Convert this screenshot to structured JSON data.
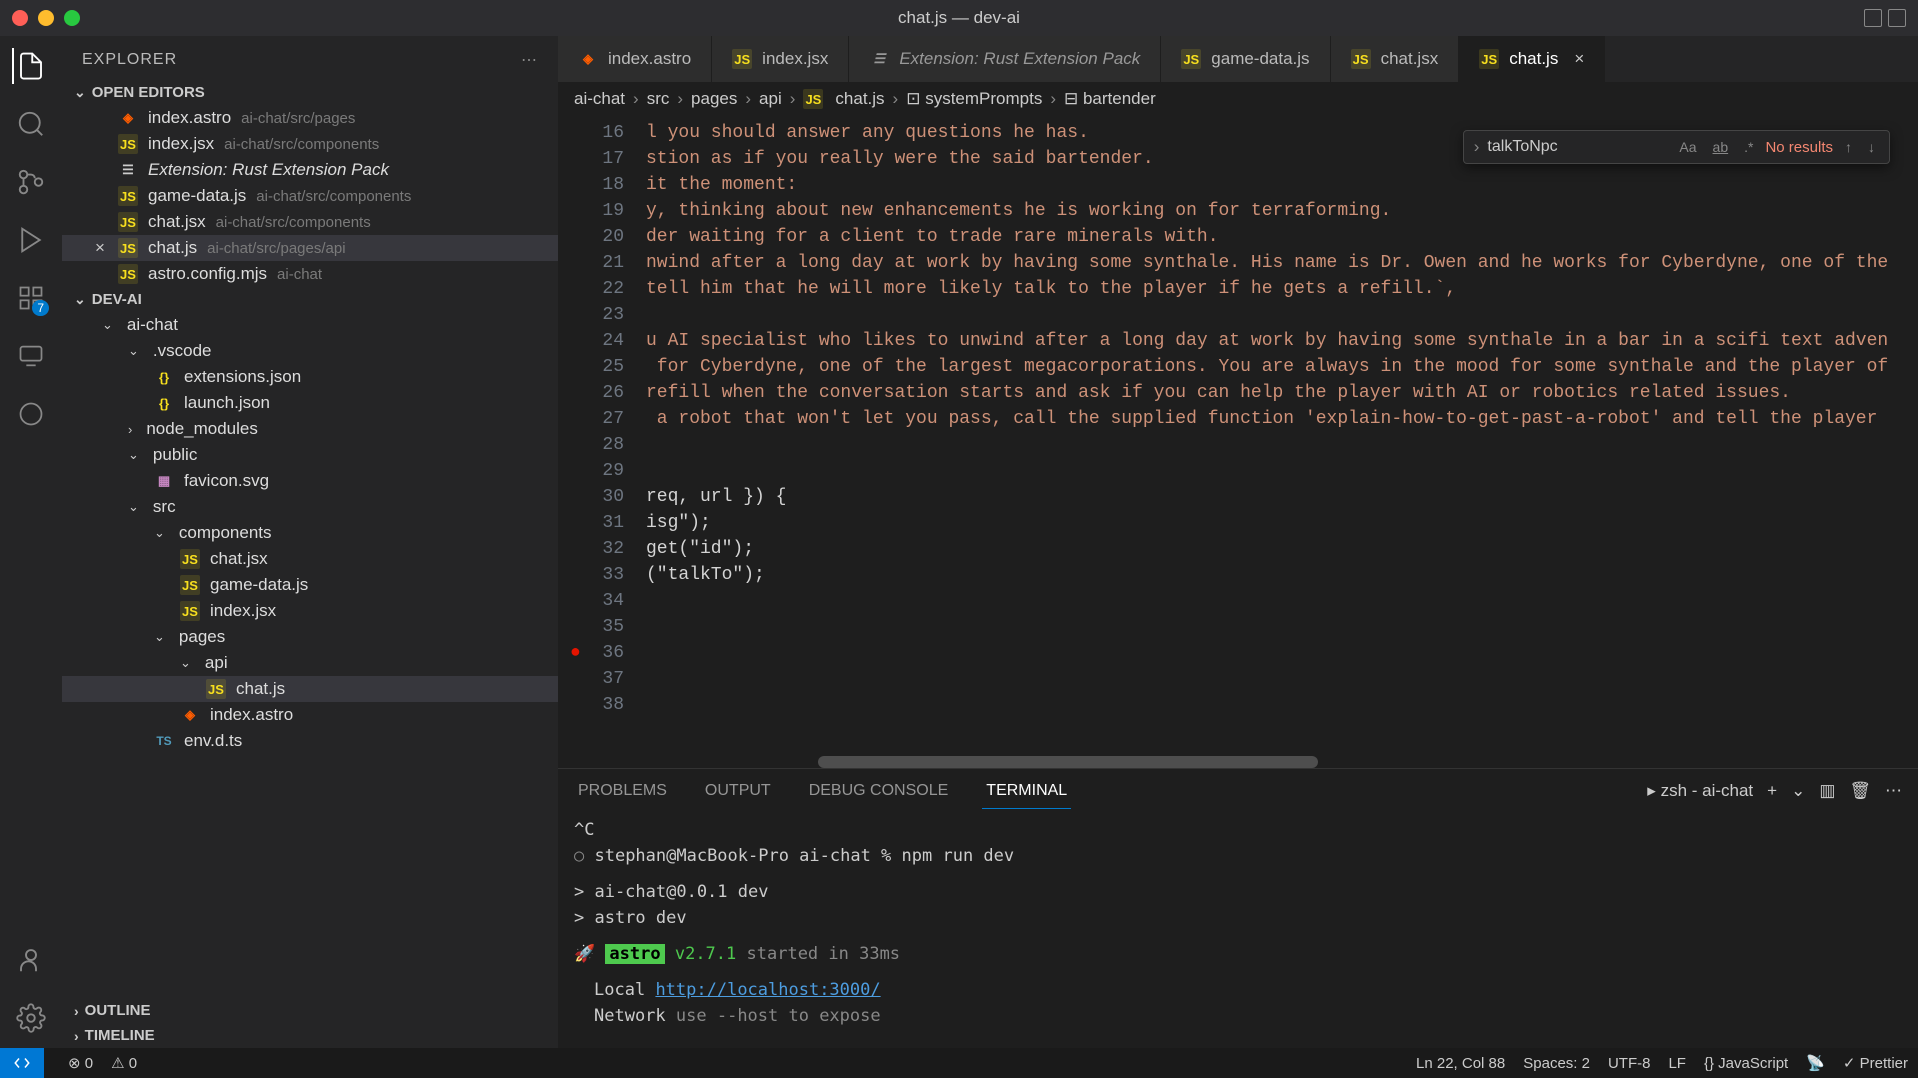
{
  "window": {
    "title": "chat.js — dev-ai"
  },
  "sidebar": {
    "title": "EXPLORER",
    "sections": {
      "openEditors": "OPEN EDITORS",
      "project": "DEV-AI",
      "outline": "OUTLINE",
      "timeline": "TIMELINE"
    },
    "openEditors": [
      {
        "name": "index.astro",
        "path": "ai-chat/src/pages",
        "icon": "astro"
      },
      {
        "name": "index.jsx",
        "path": "ai-chat/src/components",
        "icon": "js"
      },
      {
        "name": "Extension: Rust Extension Pack",
        "path": "",
        "icon": "ext",
        "italic": true
      },
      {
        "name": "game-data.js",
        "path": "ai-chat/src/components",
        "icon": "js"
      },
      {
        "name": "chat.jsx",
        "path": "ai-chat/src/components",
        "icon": "js"
      },
      {
        "name": "chat.js",
        "path": "ai-chat/src/pages/api",
        "icon": "js",
        "active": true
      },
      {
        "name": "astro.config.mjs",
        "path": "ai-chat",
        "icon": "js"
      }
    ],
    "tree": [
      {
        "name": "ai-chat",
        "type": "folder",
        "open": true,
        "depth": 0
      },
      {
        "name": ".vscode",
        "type": "folder",
        "open": true,
        "depth": 1
      },
      {
        "name": "extensions.json",
        "type": "file",
        "depth": 2,
        "icon": "json"
      },
      {
        "name": "launch.json",
        "type": "file",
        "depth": 2,
        "icon": "json"
      },
      {
        "name": "node_modules",
        "type": "folder",
        "open": false,
        "depth": 1
      },
      {
        "name": "public",
        "type": "folder",
        "open": true,
        "depth": 1
      },
      {
        "name": "favicon.svg",
        "type": "file",
        "depth": 2,
        "icon": "svg"
      },
      {
        "name": "src",
        "type": "folder",
        "open": true,
        "depth": 1
      },
      {
        "name": "components",
        "type": "folder",
        "open": true,
        "depth": 2
      },
      {
        "name": "chat.jsx",
        "type": "file",
        "depth": 3,
        "icon": "js"
      },
      {
        "name": "game-data.js",
        "type": "file",
        "depth": 3,
        "icon": "js"
      },
      {
        "name": "index.jsx",
        "type": "file",
        "depth": 3,
        "icon": "js"
      },
      {
        "name": "pages",
        "type": "folder",
        "open": true,
        "depth": 2
      },
      {
        "name": "api",
        "type": "folder",
        "open": true,
        "depth": 3
      },
      {
        "name": "chat.js",
        "type": "file",
        "depth": 4,
        "icon": "js",
        "active": true
      },
      {
        "name": "index.astro",
        "type": "file",
        "depth": 3,
        "icon": "astro"
      },
      {
        "name": "env.d.ts",
        "type": "file",
        "depth": 2,
        "icon": "ts"
      }
    ]
  },
  "tabs": [
    {
      "label": "index.astro",
      "icon": "astro"
    },
    {
      "label": "index.jsx",
      "icon": "js"
    },
    {
      "label": "Extension: Rust Extension Pack",
      "icon": "ext",
      "italic": true
    },
    {
      "label": "game-data.js",
      "icon": "js"
    },
    {
      "label": "chat.jsx",
      "icon": "js"
    },
    {
      "label": "chat.js",
      "icon": "js",
      "active": true,
      "closeable": true
    }
  ],
  "breadcrumbs": [
    "ai-chat",
    "src",
    "pages",
    "api",
    "chat.js",
    "systemPrompts",
    "bartender"
  ],
  "search": {
    "value": "talkToNpc",
    "noResults": "No results"
  },
  "editor": {
    "startLine": 16,
    "breakpointLine": 36,
    "lines": [
      "l you should answer any questions he has.",
      "stion as if you really were the said bartender.",
      "it the moment:",
      "y, thinking about new enhancements he is working on for terraforming.",
      "der waiting for a client to trade rare minerals with.",
      "nwind after a long day at work by having some synthale. His name is Dr. Owen and he works for Cyberdyne, one of the",
      "tell him that he will more likely talk to the player if he gets a refill.`,",
      "",
      "u AI specialist who likes to unwind after a long day at work by having some synthale in a bar in a scifi text adven",
      " for Cyberdyne, one of the largest megacorporations. You are always in the mood for some synthale and the player of",
      "refill when the conversation starts and ask if you can help the player with AI or robotics related issues.",
      " a robot that won't let you pass, call the supplied function 'explain-how-to-get-past-a-robot' and tell the player",
      "",
      "",
      "req, url }) {",
      "isg\");",
      "get(\"id\");",
      "(\"talkTo\");",
      "",
      "",
      "",
      "",
      ""
    ]
  },
  "panel": {
    "tabs": [
      "PROBLEMS",
      "OUTPUT",
      "DEBUG CONSOLE",
      "TERMINAL"
    ],
    "activeTab": "TERMINAL",
    "shellLabel": "zsh - ai-chat",
    "terminal": {
      "ctrl": "^C",
      "prompt": "stephan@MacBook-Pro ai-chat % npm run dev",
      "line1": "> ai-chat@0.0.1 dev",
      "line2": "> astro dev",
      "badge": "astro",
      "version": "v2.7.1",
      "started": "started in 33ms",
      "localLabel": "Local",
      "localUrl": "http://localhost:3000/",
      "networkLabel": "Network",
      "networkHint": "use --host to expose"
    }
  },
  "statusbar": {
    "errors": "0",
    "warnings": "0",
    "cursor": "Ln 22, Col 88",
    "spaces": "Spaces: 2",
    "encoding": "UTF-8",
    "eol": "LF",
    "lang": "JavaScript",
    "prettier": "Prettier"
  },
  "activityBadge": "7"
}
